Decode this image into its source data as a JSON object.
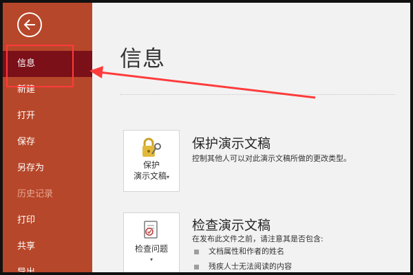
{
  "sidebar": {
    "back_icon": "arrow-left-icon",
    "items": [
      {
        "label": "信息",
        "state": "active"
      },
      {
        "label": "新建",
        "state": "normal"
      },
      {
        "label": "打开",
        "state": "normal"
      },
      {
        "label": "保存",
        "state": "normal"
      },
      {
        "label": "另存为",
        "state": "normal"
      },
      {
        "label": "历史记录",
        "state": "disabled"
      },
      {
        "label": "打印",
        "state": "normal"
      },
      {
        "label": "共享",
        "state": "normal"
      },
      {
        "label": "导出",
        "state": "normal"
      }
    ]
  },
  "main": {
    "title": "信息",
    "protect": {
      "button_line1": "保护",
      "button_line2": "演示文稿",
      "button_icon": "lock-key-icon",
      "title": "保护演示文稿",
      "description": "控制其他人可以对此演示文稿所做的更改类型。"
    },
    "inspect": {
      "button_label": "检查问题",
      "button_icon": "inspect-document-icon",
      "title": "检查演示文稿",
      "description": "在发布此文件之前，请注意其是否包含:",
      "bullets": [
        "文档属性和作者的姓名",
        "残疾人士无法阅读的内容"
      ]
    }
  },
  "colors": {
    "sidebar_bg": "#b7472a",
    "active_item_bg": "#7b1019",
    "annotation_red": "#ff3b3b"
  }
}
